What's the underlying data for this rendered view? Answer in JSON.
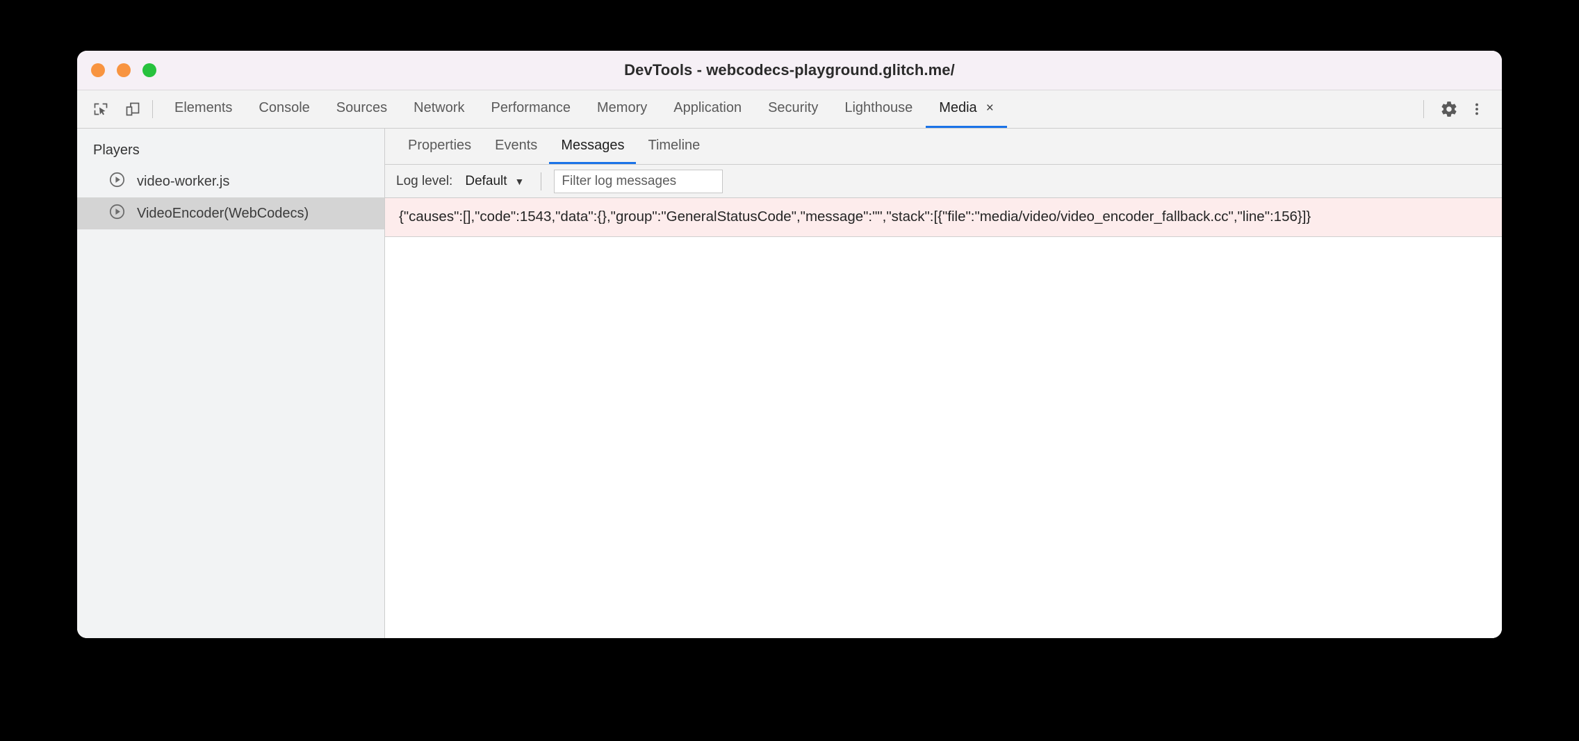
{
  "window": {
    "title": "DevTools - webcodecs-playground.glitch.me/",
    "traffic_lights": {
      "close": "close-button",
      "minimize": "minimize-button",
      "maximize": "maximize-button",
      "close_color": "#f89440",
      "minimize_color": "#f89440",
      "maximize_color": "#27c23d"
    }
  },
  "tabbar": {
    "left_icons": [
      {
        "name": "inspect-element-icon"
      },
      {
        "name": "device-toolbar-icon"
      }
    ],
    "tabs": [
      {
        "label": "Elements",
        "active": false
      },
      {
        "label": "Console",
        "active": false
      },
      {
        "label": "Sources",
        "active": false
      },
      {
        "label": "Network",
        "active": false
      },
      {
        "label": "Performance",
        "active": false
      },
      {
        "label": "Memory",
        "active": false
      },
      {
        "label": "Application",
        "active": false
      },
      {
        "label": "Security",
        "active": false
      },
      {
        "label": "Lighthouse",
        "active": false
      },
      {
        "label": "Media",
        "active": true,
        "closable": true,
        "close_label": "×"
      }
    ],
    "right_icons": [
      {
        "name": "settings-gear-icon"
      },
      {
        "name": "more-options-icon"
      }
    ],
    "accent_color": "#1a73e8"
  },
  "sidebar": {
    "header": "Players",
    "items": [
      {
        "label": "video-worker.js",
        "icon": "play-circle-icon",
        "selected": false
      },
      {
        "label": "VideoEncoder(WebCodecs)",
        "icon": "play-circle-icon",
        "selected": true
      }
    ]
  },
  "main": {
    "subtabs": [
      {
        "label": "Properties",
        "active": false
      },
      {
        "label": "Events",
        "active": false
      },
      {
        "label": "Messages",
        "active": true
      },
      {
        "label": "Timeline",
        "active": false
      }
    ],
    "filterbar": {
      "log_level_label": "Log level:",
      "log_level_value": "Default",
      "caret": "▼",
      "filter_placeholder": "Filter log messages",
      "filter_value": ""
    },
    "messages": [
      {
        "level": "error",
        "background": "#fdecec",
        "text": "{\"causes\":[],\"code\":1543,\"data\":{},\"group\":\"GeneralStatusCode\",\"message\":\"\",\"stack\":[{\"file\":\"media/video/video_encoder_fallback.cc\",\"line\":156}]}"
      }
    ]
  }
}
